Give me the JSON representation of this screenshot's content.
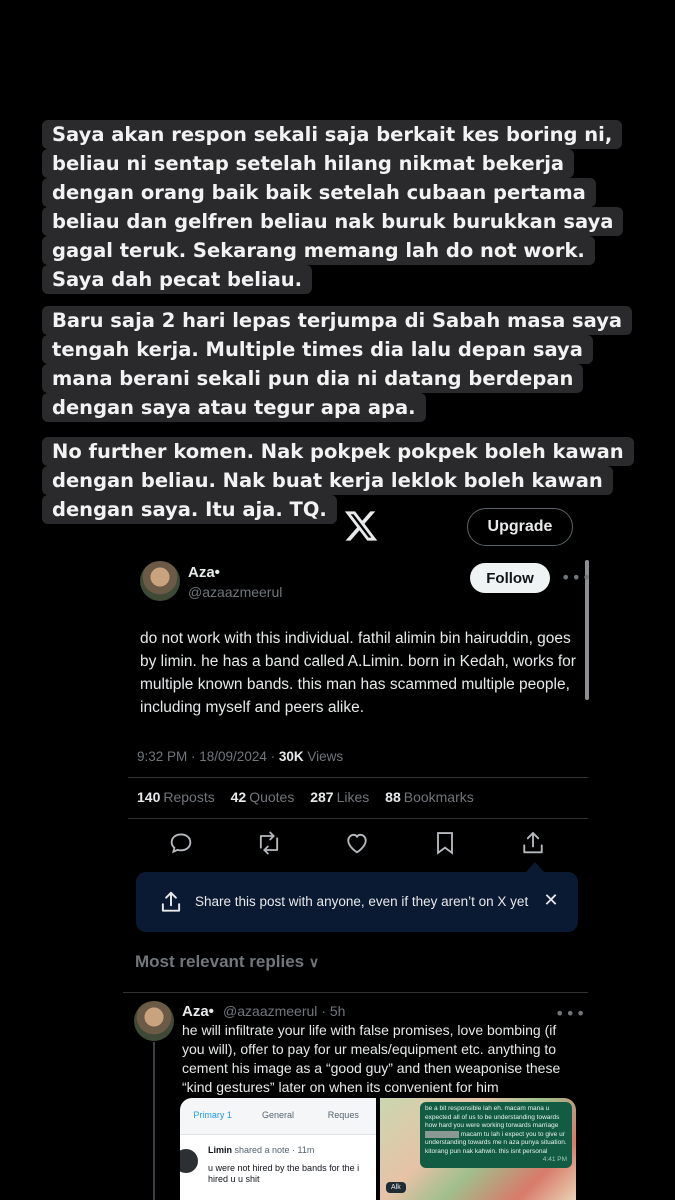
{
  "story": {
    "caption_paragraphs": [
      [
        "Saya akan respon sekali saja berkait kes boring ni,",
        "beliau ni sentap setelah hilang nikmat bekerja",
        "dengan orang baik baik setelah cubaan pertama",
        "beliau dan gelfren beliau nak buruk burukkan saya",
        "gagal teruk. Sekarang memang lah do not work.",
        "Saya dah pecat beliau."
      ],
      [
        "Baru saja 2 hari lepas terjumpa di Sabah masa saya",
        "tengah kerja. Multiple times dia lalu depan saya",
        "mana berani sekali pun dia ni datang berdepan",
        "dengan saya atau tegur apa apa."
      ],
      [
        "No further komen. Nak pokpek pokpek boleh kawan",
        "dengan beliau. Nak buat kerja leklok boleh kawan",
        "dengan saya. Itu aja. TQ."
      ]
    ]
  },
  "header": {
    "logo_icon": "x-logo-icon",
    "upgrade_label": "Upgrade"
  },
  "tweet": {
    "author_name": "Aza•",
    "author_handle": "@azaazmeerul",
    "follow_label": "Follow",
    "more_icon": "•••",
    "text": "do not work with this individual. fathil alimin bin hairuddin, goes by limin. he has a band called A.Limin. born in Kedah, works for multiple known bands. this man has scammed multiple people, including myself and peers alike.",
    "time": "9:32 PM · 18/09/2024 · ",
    "views_count": "30K",
    "views_label": " Views",
    "stats": {
      "reposts_count": "140",
      "reposts_label": "Reposts",
      "quotes_count": "42",
      "quotes_label": "Quotes",
      "likes_count": "287",
      "likes_label": "Likes",
      "bookmarks_count": "88",
      "bookmarks_label": "Bookmarks"
    },
    "actions": [
      "reply-icon",
      "repost-icon",
      "like-icon",
      "bookmark-icon",
      "share-icon"
    ]
  },
  "share_banner": {
    "text": "Share this post with anyone, even if they aren’t on X yet",
    "close": "✕"
  },
  "replies": {
    "heading": "Most relevant replies",
    "chevron": "∨",
    "first": {
      "author_name": "Aza•",
      "meta": "@azaazmeerul · 5h",
      "text": "he will infiltrate your life with false promises, love bombing (if you will), offer to pay for ur meals/equipment etc. anything to cement his image as a “good guy” and then weaponise these “kind gestures” later on when its convenient for him",
      "attachment_a": {
        "tabs": [
          "Primary 1",
          "General",
          "Reques"
        ],
        "notif_name": "Limin",
        "notif_meta": " shared a note · 11m",
        "notif_body": "u were not hired by the bands for the i hired u u shit"
      },
      "attachment_b": {
        "chat_before": "be a bit responsible lah eh. macam mana u expected all of us to be understanding towards how hard you were working torwards marriage",
        "chat_after": " macam tu lah i expect you to give ur understanding towards me n aza punya situation. kitorang pun nak kahwin. this isnt personal",
        "chat_time": "4:41 PM",
        "sender_tag": "Alk"
      }
    }
  }
}
